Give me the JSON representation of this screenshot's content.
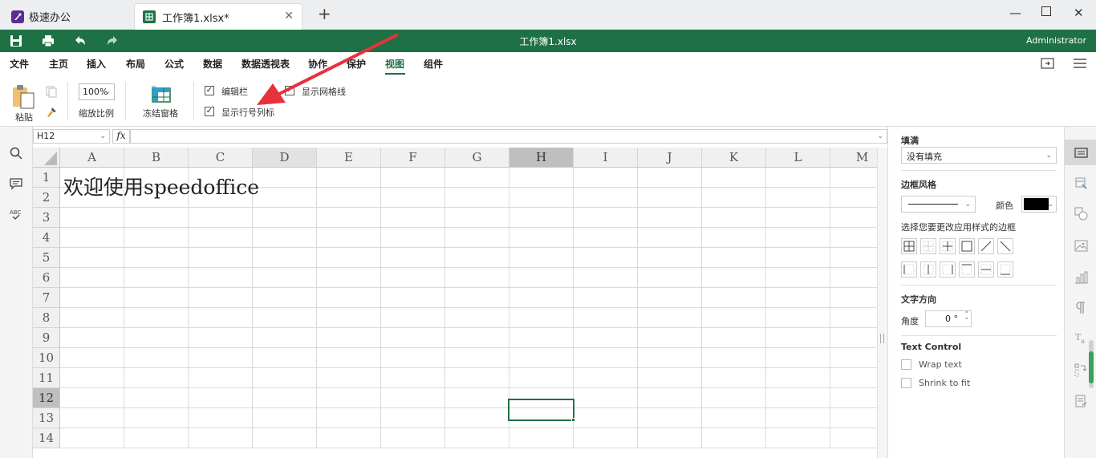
{
  "tabs": [
    {
      "label": "极速办公"
    },
    {
      "label": "工作簿1.xlsx*"
    }
  ],
  "title": "工作簿1.xlsx",
  "user": "Administrator",
  "menu": [
    "文件",
    "主页",
    "插入",
    "布局",
    "公式",
    "数据",
    "数据透视表",
    "协作",
    "保护",
    "视图",
    "组件"
  ],
  "active_menu": "视图",
  "ribbon": {
    "paste": "粘贴",
    "zoom_value": "100%",
    "zoom_label": "缩放比例",
    "freeze": "冻结窗格",
    "formula_bar": "编辑栏",
    "gridlines": "显示网格线",
    "headings": "显示行号列标"
  },
  "namebox": "H12",
  "fx": "fx",
  "columns": [
    "A",
    "B",
    "C",
    "D",
    "E",
    "F",
    "G",
    "H",
    "I",
    "J",
    "K",
    "L",
    "M"
  ],
  "rows": [
    "1",
    "2",
    "3",
    "4",
    "5",
    "6",
    "7",
    "8",
    "9",
    "10",
    "11",
    "12",
    "13",
    "14"
  ],
  "cell_a1": "欢迎使用speedoffice",
  "panel": {
    "fill_title": "填满",
    "fill_value": "没有填充",
    "border_title": "边框风格",
    "color_label": "颜色",
    "border_hint": "选择您要更改应用样式的边框",
    "text_dir_title": "文字方向",
    "angle_label": "角度",
    "angle_value": "0 °",
    "text_control": "Text Control",
    "wrap": "Wrap text",
    "shrink": "Shrink to fit"
  },
  "colors": {
    "brand": "#1e7145",
    "annotation": "#e8313a"
  }
}
